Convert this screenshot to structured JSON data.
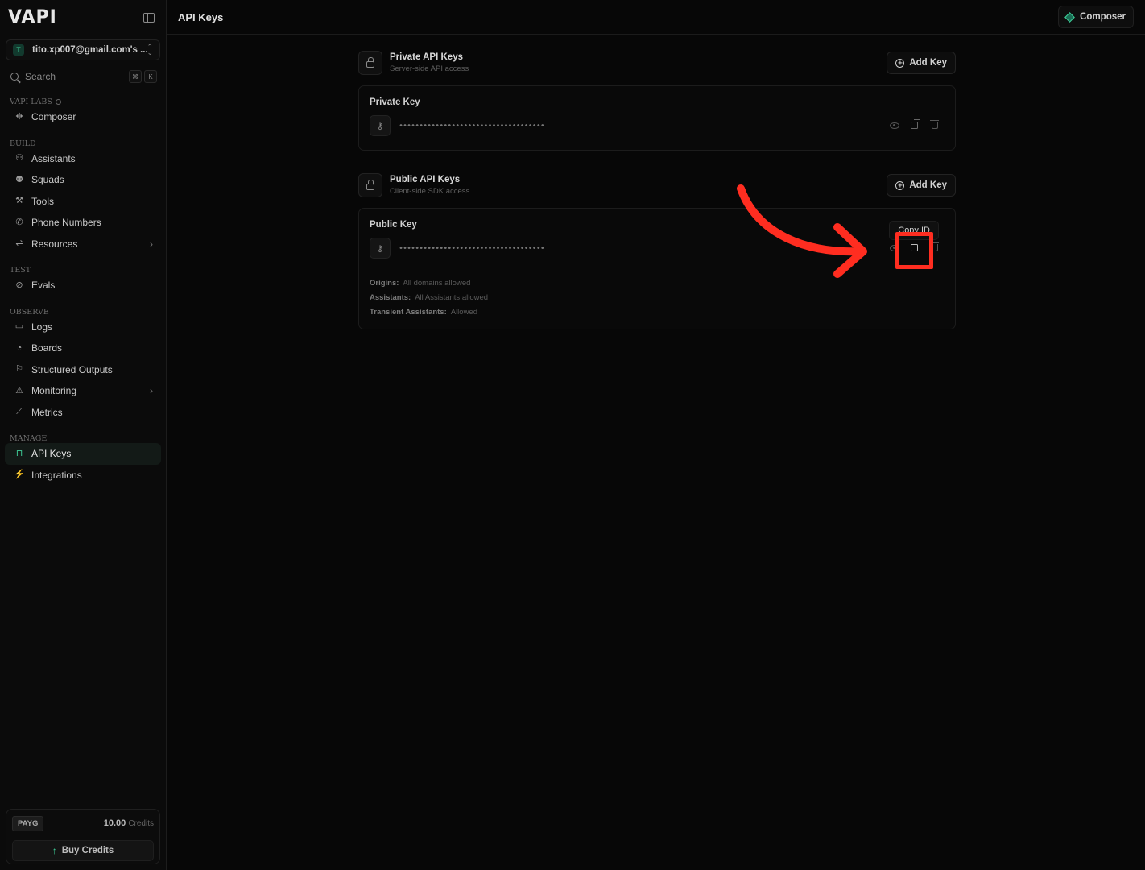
{
  "sidebar": {
    "logo": "VAPI",
    "org": {
      "avatar": "T",
      "name": "tito.xp007@gmail.com's ..."
    },
    "search": {
      "label": "Search",
      "kbd": [
        "⌘",
        "K"
      ]
    },
    "sections": {
      "vapi_labs": "VAPI LABS",
      "build": "BUILD",
      "test": "TEST",
      "observe": "OBSERVE",
      "manage": "MANAGE"
    },
    "items": {
      "composer": "Composer",
      "assistants": "Assistants",
      "squads": "Squads",
      "tools": "Tools",
      "phone_numbers": "Phone Numbers",
      "resources": "Resources",
      "evals": "Evals",
      "logs": "Logs",
      "boards": "Boards",
      "structured_outputs": "Structured Outputs",
      "monitoring": "Monitoring",
      "metrics": "Metrics",
      "api_keys": "API Keys",
      "integrations": "Integrations"
    },
    "credits": {
      "plan": "PAYG",
      "amount": "10.00",
      "unit": "Credits",
      "buy_label": "Buy Credits"
    }
  },
  "topbar": {
    "title": "API Keys",
    "composer_label": "Composer"
  },
  "private_section": {
    "title": "Private API Keys",
    "subtitle": "Server-side API access",
    "add_label": "Add Key",
    "card_title": "Private Key",
    "masked_key": "••••••••••••••••••••••••••••••••••••"
  },
  "public_section": {
    "title": "Public API Keys",
    "subtitle": "Client-side SDK access",
    "add_label": "Add Key",
    "card_title": "Public Key",
    "masked_key": "••••••••••••••••••••••••••••••••••••",
    "tooltip": "Copy ID",
    "meta": [
      {
        "key": "Origins:",
        "value": "All domains allowed"
      },
      {
        "key": "Assistants:",
        "value": "All Assistants allowed"
      },
      {
        "key": "Transient Assistants:",
        "value": "Allowed"
      }
    ]
  },
  "colors": {
    "accent": "#3fd19a",
    "annotation": "#ff2d20",
    "background": "#070707"
  }
}
